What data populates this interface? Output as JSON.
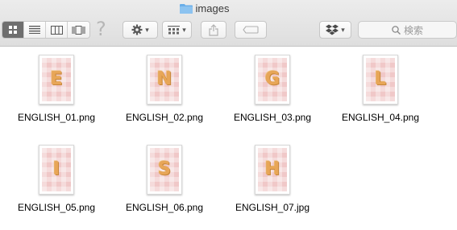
{
  "window": {
    "title": "images"
  },
  "toolbar": {
    "view_modes": [
      "icon-view",
      "list-view",
      "column-view",
      "cover-flow-view"
    ],
    "active_view": 0,
    "help": "?",
    "search_placeholder": "検索"
  },
  "files": [
    {
      "name": "ENGLISH_01.png",
      "letter": "E"
    },
    {
      "name": "ENGLISH_02.png",
      "letter": "N"
    },
    {
      "name": "ENGLISH_03.png",
      "letter": "G"
    },
    {
      "name": "ENGLISH_04.png",
      "letter": "L"
    },
    {
      "name": "ENGLISH_05.png",
      "letter": "I"
    },
    {
      "name": "ENGLISH_06.png",
      "letter": "S"
    },
    {
      "name": "ENGLISH_07.jpg",
      "letter": "H"
    }
  ],
  "colors": {
    "thumb_bg": "#f0c8c8",
    "cookie": "#e8a657",
    "folder": "#6aaee8"
  }
}
